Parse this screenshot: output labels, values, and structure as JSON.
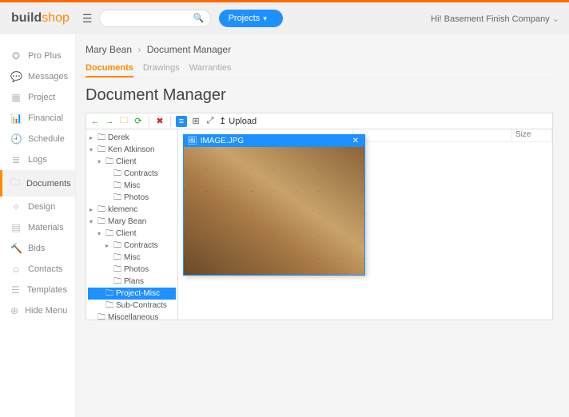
{
  "brand": {
    "left": "build",
    "right": "shop"
  },
  "search": {
    "placeholder": ""
  },
  "projects_btn": "Projects",
  "company_greeting": "Hi! Basement Finish Company",
  "sidebar": [
    {
      "icon": "✪",
      "label": "Pro Plus"
    },
    {
      "icon": "💬",
      "label": "Messages"
    },
    {
      "icon": "▦",
      "label": "Project"
    },
    {
      "icon": "📊",
      "label": "Financial"
    },
    {
      "icon": "🕘",
      "label": "Schedule"
    },
    {
      "icon": "≣",
      "label": "Logs"
    },
    {
      "icon": "🗀",
      "label": "Documents",
      "active": true
    },
    {
      "icon": "✧",
      "label": "Design"
    },
    {
      "icon": "▤",
      "label": "Materials"
    },
    {
      "icon": "🔨",
      "label": "Bids"
    },
    {
      "icon": "☺",
      "label": "Contacts"
    },
    {
      "icon": "☰",
      "label": "Templates"
    },
    {
      "icon": "⊕",
      "label": "Hide Menu"
    }
  ],
  "breadcrumb": {
    "a": "Mary Bean",
    "b": "Document Manager"
  },
  "tabs": [
    {
      "label": "Documents",
      "active": true
    },
    {
      "label": "Drawings"
    },
    {
      "label": "Warranties"
    }
  ],
  "page_title": "Document Manager",
  "toolbar": {
    "back": "←",
    "forward": "→",
    "open": "🗀",
    "refresh": "⟳",
    "delete": "✖",
    "view_list": "≡",
    "view_grid": "⊞",
    "resize": "⤢",
    "upload": "↥ Upload"
  },
  "tree": [
    {
      "indent": 0,
      "arrow": "▸",
      "icon": "🗀",
      "label": "Derek"
    },
    {
      "indent": 0,
      "arrow": "▾",
      "icon": "🗀",
      "label": "Ken Atkinson"
    },
    {
      "indent": 1,
      "arrow": "▾",
      "icon": "🗀",
      "label": "Client"
    },
    {
      "indent": 2,
      "arrow": "",
      "icon": "🗀",
      "label": "Contracts"
    },
    {
      "indent": 2,
      "arrow": "",
      "icon": "🗀",
      "label": "Misc"
    },
    {
      "indent": 2,
      "arrow": "",
      "icon": "🗀",
      "label": "Photos"
    },
    {
      "indent": 0,
      "arrow": "▸",
      "icon": "🗀",
      "label": "klemenc"
    },
    {
      "indent": 0,
      "arrow": "▾",
      "icon": "🗀",
      "label": "Mary Bean"
    },
    {
      "indent": 1,
      "arrow": "▾",
      "icon": "🗀",
      "label": "Client"
    },
    {
      "indent": 2,
      "arrow": "▸",
      "icon": "🗀",
      "label": "Contracts"
    },
    {
      "indent": 2,
      "arrow": "",
      "icon": "🗀",
      "label": "Misc"
    },
    {
      "indent": 2,
      "arrow": "",
      "icon": "🗀",
      "label": "Photos"
    },
    {
      "indent": 2,
      "arrow": "",
      "icon": "🗀",
      "label": "Plans"
    },
    {
      "indent": 1,
      "arrow": "",
      "icon": "🗀",
      "label": "Project-Misc",
      "selected": true
    },
    {
      "indent": 1,
      "arrow": "",
      "icon": "🗀",
      "label": "Sub-Contracts"
    },
    {
      "indent": 0,
      "arrow": "",
      "icon": "🗀",
      "label": "Miscellaneous"
    }
  ],
  "list_columns": {
    "name": "",
    "size": "Size"
  },
  "viewer": {
    "title": "IMAGE.JPG"
  }
}
